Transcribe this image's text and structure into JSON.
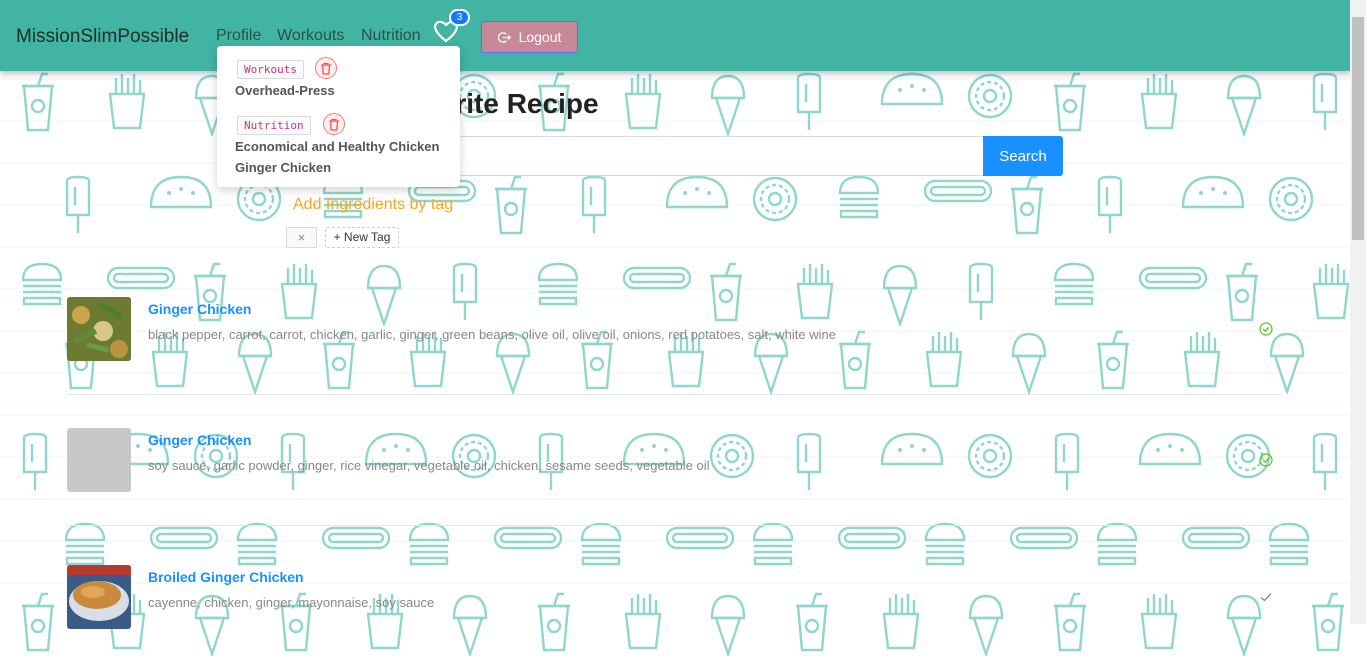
{
  "nav": {
    "brand": "MissionSlimPossible",
    "links": [
      "Profile",
      "Workouts",
      "Nutrition"
    ],
    "favourites_count": "3",
    "logout_label": "Logout"
  },
  "dropdown": {
    "items": [
      {
        "tag": "Workouts",
        "title": "Overhead-Press"
      },
      {
        "tag": "Nutrition",
        "title_line1": "Economical and Healthy Chicken",
        "title_line2": "Ginger Chicken"
      }
    ]
  },
  "page_title": "avourite Recipe",
  "search": {
    "button_label": "Search",
    "placeholder": ""
  },
  "tags": {
    "heading": "Add Ingredients by tag",
    "remove_symbol": "×",
    "new_tag_label": "New Tag"
  },
  "recipes": [
    {
      "name": "Ginger Chicken",
      "ingredients": "black pepper, carrot, carrot, chicken, garlic, ginger, green beans, olive oil, olive oil, onions, red potatoes, salt, white wine",
      "status": "check-circle"
    },
    {
      "name": "Ginger Chicken",
      "ingredients": "soy sauce, garlic powder, ginger, rice vinegar, vegetable oil, chicken, sesame seeds, vegetable oil",
      "status": "check-circle"
    },
    {
      "name": "Broiled Ginger Chicken",
      "ingredients": "cayenne, chicken, ginger, mayonnaise, soy sauce",
      "status": "check"
    }
  ],
  "colors": {
    "navbar": "#41b4a3",
    "pattern": "#8fd6cb",
    "link": "#1890ff",
    "tag_heading": "#f5a623",
    "logout": "#c7889a",
    "success": "#52c41a"
  }
}
